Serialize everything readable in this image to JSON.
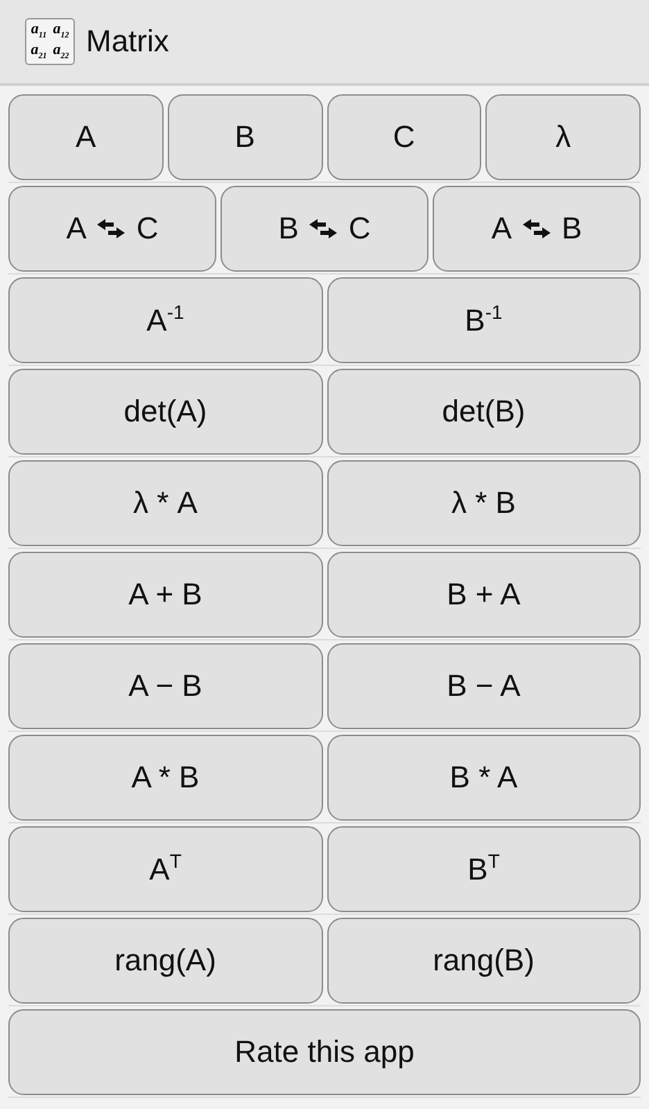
{
  "title_bar": {
    "app_icon": [
      "a$_{11}$",
      "a$_{12}$",
      "a$_{21}$",
      "a$_{22}$"
    ],
    "title": "Matrix"
  },
  "rows": [
    {
      "buttons": [
        {
          "kind": "plain",
          "label": "A"
        },
        {
          "kind": "plain",
          "label": "B"
        },
        {
          "kind": "plain",
          "label": "C"
        },
        {
          "kind": "plain",
          "label": "λ"
        }
      ]
    },
    {
      "buttons": [
        {
          "kind": "swap",
          "left": "A",
          "right": "C"
        },
        {
          "kind": "swap",
          "left": "B",
          "right": "C"
        },
        {
          "kind": "swap",
          "left": "A",
          "right": "B"
        }
      ]
    },
    {
      "buttons": [
        {
          "kind": "plain",
          "label": "A$^{-1}$"
        },
        {
          "kind": "plain",
          "label": "B$^{-1}$"
        }
      ]
    },
    {
      "buttons": [
        {
          "kind": "plain",
          "label": "det(A)"
        },
        {
          "kind": "plain",
          "label": "det(B)"
        }
      ]
    },
    {
      "buttons": [
        {
          "kind": "plain",
          "label": "λ * A"
        },
        {
          "kind": "plain",
          "label": "λ * B"
        }
      ]
    },
    {
      "buttons": [
        {
          "kind": "plain",
          "label": "A + B"
        },
        {
          "kind": "plain",
          "label": "B + A"
        }
      ]
    },
    {
      "buttons": [
        {
          "kind": "plain",
          "label": "A − B"
        },
        {
          "kind": "plain",
          "label": "B − A"
        }
      ]
    },
    {
      "buttons": [
        {
          "kind": "plain",
          "label": "A * B"
        },
        {
          "kind": "plain",
          "label": "B * A"
        }
      ]
    },
    {
      "buttons": [
        {
          "kind": "plain",
          "label": "A$^{T}$"
        },
        {
          "kind": "plain",
          "label": "B$^{T}$"
        }
      ]
    },
    {
      "buttons": [
        {
          "kind": "plain",
          "label": "rang(A)"
        },
        {
          "kind": "plain",
          "label": "rang(B)"
        }
      ]
    },
    {
      "buttons": [
        {
          "kind": "plain",
          "label": "Rate this app"
        }
      ]
    }
  ]
}
